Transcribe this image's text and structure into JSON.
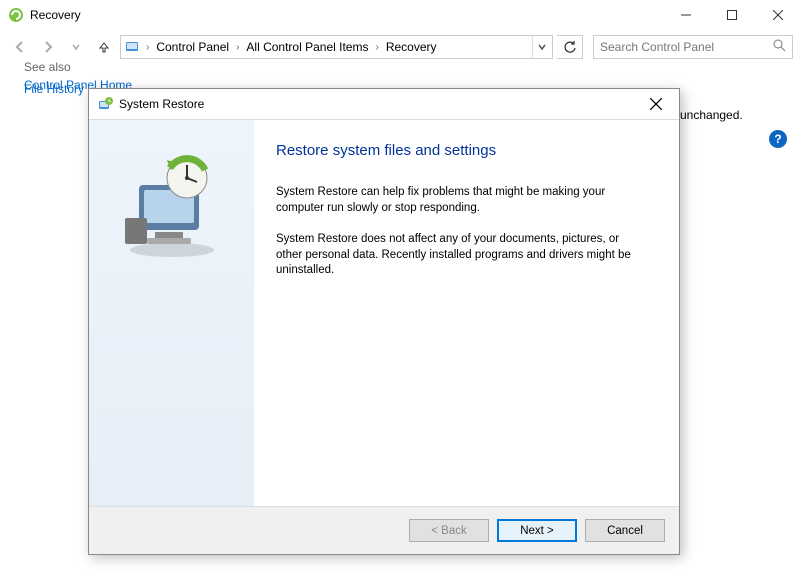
{
  "window": {
    "title": "Recovery",
    "help_badge": "?"
  },
  "breadcrumb": {
    "items": [
      "Control Panel",
      "All Control Panel Items",
      "Recovery"
    ]
  },
  "search": {
    "placeholder": "Search Control Panel"
  },
  "sidebar": {
    "home": "Control Panel Home",
    "see_also": "See also",
    "file_history": "File History"
  },
  "background_snippet": "ic unchanged.",
  "dialog": {
    "title": "System Restore",
    "heading": "Restore system files and settings",
    "para1": "System Restore can help fix problems that might be making your computer run slowly or stop responding.",
    "para2": "System Restore does not affect any of your documents, pictures, or other personal data. Recently installed programs and drivers might be uninstalled.",
    "buttons": {
      "back": "< Back",
      "next": "Next >",
      "cancel": "Cancel"
    }
  }
}
